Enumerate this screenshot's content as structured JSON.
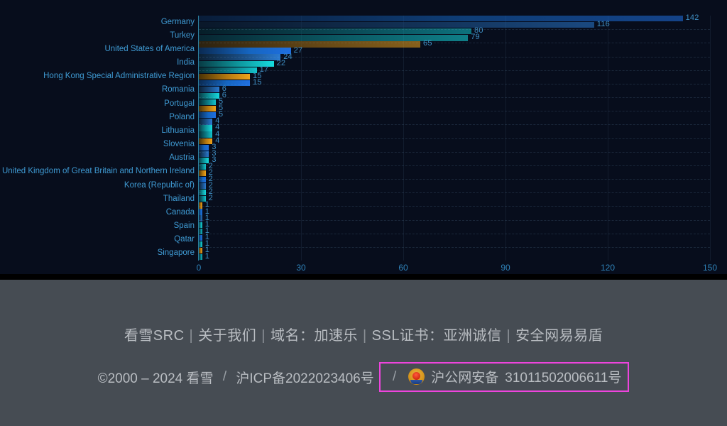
{
  "chart_data": {
    "type": "bar",
    "orientation": "horizontal",
    "title": "",
    "xlabel": "",
    "ylabel": "",
    "xlim": [
      0,
      150
    ],
    "xticks": [
      0,
      30,
      60,
      90,
      120,
      150
    ],
    "grid": true,
    "legend": null,
    "categories": [
      "Germany",
      "Turkey",
      "United States of America",
      "India",
      "Hong Kong Special Administrative Region",
      "Romania",
      "Portugal",
      "Poland",
      "Lithuania",
      "Slovenia",
      "Austria",
      "United Kingdom of Great Britain and Northern Ireland",
      "Korea (Republic of)",
      "Thailand",
      "Canada",
      "Spain",
      "Qatar",
      "Singapore"
    ],
    "values": [
      142,
      116,
      80,
      79,
      65,
      27,
      24,
      22,
      17,
      15,
      15,
      6,
      6,
      5,
      5,
      5,
      4,
      4,
      4,
      4,
      3,
      3,
      3,
      2,
      2,
      2,
      2,
      2,
      2,
      1,
      1,
      1,
      1,
      1,
      1,
      1,
      1,
      1
    ],
    "bars": [
      {
        "value": 142,
        "label": "142",
        "color": "b-blue"
      },
      {
        "value": 116,
        "label": "116",
        "color": "b-steel"
      },
      {
        "value": 80,
        "label": "80",
        "color": "b-teal"
      },
      {
        "value": 79,
        "label": "79",
        "color": "b-cyan"
      },
      {
        "value": 65,
        "label": "65",
        "color": "b-orange"
      },
      {
        "value": 27,
        "label": "27",
        "color": "b-blue"
      },
      {
        "value": 24,
        "label": "24",
        "color": "b-steel"
      },
      {
        "value": 22,
        "label": "22",
        "color": "b-cyan"
      },
      {
        "value": 17,
        "label": "17",
        "color": "b-teal"
      },
      {
        "value": 15,
        "label": "15",
        "color": "b-orange"
      },
      {
        "value": 15,
        "label": "15",
        "color": "b-blue"
      },
      {
        "value": 6,
        "label": "6",
        "color": "b-steel"
      },
      {
        "value": 6,
        "label": "6",
        "color": "b-cyan"
      },
      {
        "value": 5,
        "label": "5",
        "color": "b-teal"
      },
      {
        "value": 5,
        "label": "5",
        "color": "b-orange"
      },
      {
        "value": 5,
        "label": "5",
        "color": "b-blue"
      },
      {
        "value": 4,
        "label": "4",
        "color": "b-steel"
      },
      {
        "value": 4,
        "label": "4",
        "color": "b-cyan"
      },
      {
        "value": 4,
        "label": "4",
        "color": "b-teal"
      },
      {
        "value": 4,
        "label": "4",
        "color": "b-orange"
      },
      {
        "value": 3,
        "label": "3",
        "color": "b-blue"
      },
      {
        "value": 3,
        "label": "3",
        "color": "b-steel"
      },
      {
        "value": 3,
        "label": "3",
        "color": "b-cyan"
      },
      {
        "value": 2,
        "label": "2",
        "color": "b-teal"
      },
      {
        "value": 2,
        "label": "2",
        "color": "b-orange"
      },
      {
        "value": 2,
        "label": "2",
        "color": "b-blue"
      },
      {
        "value": 2,
        "label": "2",
        "color": "b-steel"
      },
      {
        "value": 2,
        "label": "2",
        "color": "b-cyan"
      },
      {
        "value": 2,
        "label": "2",
        "color": "b-teal"
      },
      {
        "value": 1,
        "label": "1",
        "color": "b-orange"
      },
      {
        "value": 1,
        "label": "1",
        "color": "b-blue"
      },
      {
        "value": 1,
        "label": "1",
        "color": "b-steel"
      },
      {
        "value": 1,
        "label": "1",
        "color": "b-cyan"
      },
      {
        "value": 1,
        "label": "1",
        "color": "b-teal"
      },
      {
        "value": 1,
        "label": "1",
        "color": "b-blue"
      },
      {
        "value": 1,
        "label": "1",
        "color": "b-cyan"
      },
      {
        "value": 1,
        "label": "1",
        "color": "b-orange"
      },
      {
        "value": 1,
        "label": "1",
        "color": "b-teal"
      }
    ],
    "colors": {
      "background": "#070d1c",
      "axis": "#2d7f9e",
      "tick_text": "#2f82b8",
      "category_text": "#3f9bd4",
      "value_text": "#3f8fc4",
      "bar_blue": "#1f6fe0",
      "bar_cyan": "#16dbe0",
      "bar_orange": "#f0a41a"
    }
  },
  "footer": {
    "links": [
      {
        "text": "看雪SRC"
      },
      {
        "text": "关于我们"
      },
      {
        "text": "域名：加速乐"
      },
      {
        "text": "SSL证书：亚洲诚信"
      },
      {
        "text": "安全网易易盾"
      }
    ],
    "separator": "|",
    "copyright": "©2000 – 2024 看雪",
    "slash": "/",
    "icp": "沪ICP备2022023406号",
    "beian_label": "沪公网安备",
    "beian_number": "31011502006611号",
    "highlight_color": "#ee44dd",
    "background_color": "#464c53",
    "text_color": "#b9bdc2"
  }
}
